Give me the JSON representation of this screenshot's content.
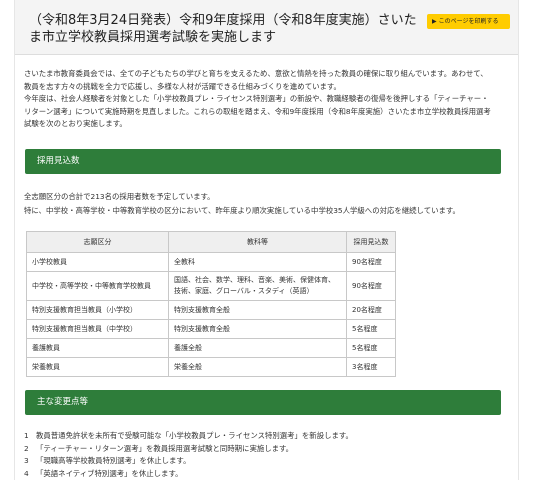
{
  "header": {
    "title": "（令和8年3月24日発表）令和9年度採用（令和8年度実施）さいたま市立学校教員採用選考試験を実施します",
    "print_button": "このページを印刷する"
  },
  "intro": {
    "paragraph1": "さいたま市教育委員会では、全ての子どもたちの学びと育ちを支えるため、意欲と情熱を持った教員の確保に取り組んでいます。あわせて、教員を志す方々の挑戦を全力で応援し、多様な人材が活躍できる仕組みづくりを進めています。",
    "paragraph2": "今年度は、社会人経験者を対象とした「小学校教員プレ・ライセンス特別選考」の新設や、教職経験者の復帰を後押しする「ティーチャー・リターン選考」について実施時期を見直しました。これらの取組を踏まえ、令和9年度採用（令和8年度実施）さいたま市立学校教員採用選考試験を次のとおり実施します。"
  },
  "sections": {
    "hiring_title": "採用見込数",
    "changes_title": "主な変更点等"
  },
  "hiring": {
    "line1": "全志願区分の合計で213名の採用者数を予定しています。",
    "line2": "特に、中学校・高等学校・中等教育学校の区分において、昨年度より順次実施している中学校35人学級への対応を継続しています。",
    "table": {
      "headers": [
        "志願区分",
        "教科等",
        "採用見込数"
      ],
      "rows": [
        [
          "小学校教員",
          "全教科",
          "90名程度"
        ],
        [
          "中学校・高等学校・中等教育学校教員",
          "国語、社会、数学、理科、音楽、美術、保健体育、技術、家庭、グローバル・スタディ（英語）",
          "90名程度"
        ],
        [
          "特別支援教育担当教員（小学校）",
          "特別支援教育全般",
          "20名程度"
        ],
        [
          "特別支援教育担当教員（中学校）",
          "特別支援教育全般",
          "5名程度"
        ],
        [
          "養護教員",
          "養護全般",
          "5名程度"
        ],
        [
          "栄養教員",
          "栄養全般",
          "3名程度"
        ]
      ]
    }
  },
  "changes": {
    "items": [
      {
        "num": "1",
        "text": "教員普通免許状を未所有で受験可能な「小学校教員プレ・ライセンス特別選考」を新設します。"
      },
      {
        "num": "2",
        "text": "「ティーチャー・リターン選考」を教員採用選考試験と同時期に実施します。"
      },
      {
        "num": "3",
        "text": "「現職高等学校教員特別選考」を休止します。"
      },
      {
        "num": "4",
        "text": "「英語ネイティブ特別選考」を休止します。"
      }
    ]
  },
  "colors": {
    "section_header_bg": "#2e7d3a",
    "print_button_bg": "#ffcc00",
    "title_bar_bg": "#f4f4f4"
  }
}
